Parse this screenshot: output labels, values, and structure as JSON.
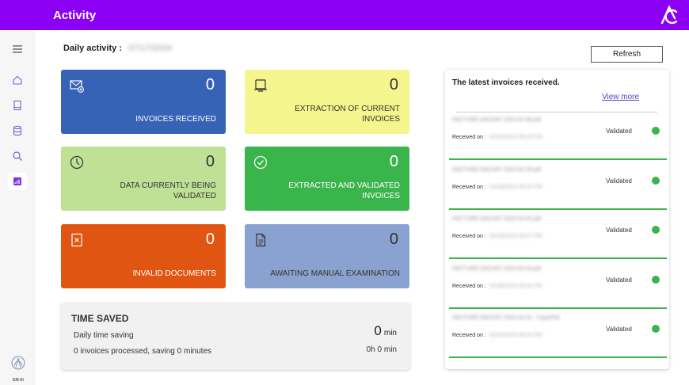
{
  "app": {
    "title": "Activity",
    "brand_label": "EM AI"
  },
  "colors": {
    "header": "#8b00f5",
    "accent_green": "#3ab54b"
  },
  "sidebar": {
    "items": [
      {
        "icon": "menu-icon",
        "active": false
      },
      {
        "icon": "home-icon",
        "active": false
      },
      {
        "icon": "document-icon",
        "active": false
      },
      {
        "icon": "database-icon",
        "active": false
      },
      {
        "icon": "search-icon",
        "active": false
      },
      {
        "icon": "activity-chart-icon",
        "active": true
      }
    ]
  },
  "daily": {
    "label": "Daily activity :",
    "date": "07/17/2024"
  },
  "toolbar": {
    "refresh_label": "Refresh"
  },
  "cards": [
    {
      "icon": "invoice-add-icon",
      "value": "0",
      "label": "INVOICES RECEIVED"
    },
    {
      "icon": "scan-icon",
      "value": "0",
      "label": "EXTRACTION OF CURRENT INVOICES"
    },
    {
      "icon": "clock-icon",
      "value": "0",
      "label": "DATA CURRENTLY BEING VALIDATED"
    },
    {
      "icon": "check-circle-icon",
      "value": "0",
      "label": "EXTRACTED AND VALIDATED INVOICES"
    },
    {
      "icon": "invalid-doc-icon",
      "value": "0",
      "label": "INVALID DOCUMENTS"
    },
    {
      "icon": "file-text-icon",
      "value": "0",
      "label": "AWAITING MANUAL EXAMINATION"
    }
  ],
  "time_saved": {
    "title": "TIME SAVED",
    "subtitle": "Daily time saving",
    "minutes_value": "0",
    "minutes_unit": "min",
    "hm": "0h 0 min",
    "processed_count": "0",
    "processed_text": "invoices processed, saving",
    "saving_minutes": "0",
    "saving_unit": "minutes"
  },
  "latest": {
    "title": "The latest invoices received.",
    "view_more": "View more",
    "received_label": "Received on :",
    "rows": [
      {
        "filename": "FACTURE DACHAT 2024-04-30.pdf",
        "received": "02/29/2024 09:20 PM",
        "status": "Validated"
      },
      {
        "filename": "FACTURE DACHAT 2024-04-29.pdf",
        "received": "02/28/2024 09:20 PM",
        "status": "Validated"
      },
      {
        "filename": "FACTURE DACHAT 2024-04-04.pdf",
        "received": "02/28/2024 06:07 PM",
        "status": "Validated"
      },
      {
        "filename": "FACTURE DACHAT 2024-05-04.pdf",
        "received": "02/28/2024 06:04 PM",
        "status": "Validated"
      },
      {
        "filename": "FACTURE DACHAT 2024-04-20 - CopiePdf",
        "received": "02/28/2024 06:04 PM",
        "status": "Validated"
      }
    ]
  }
}
